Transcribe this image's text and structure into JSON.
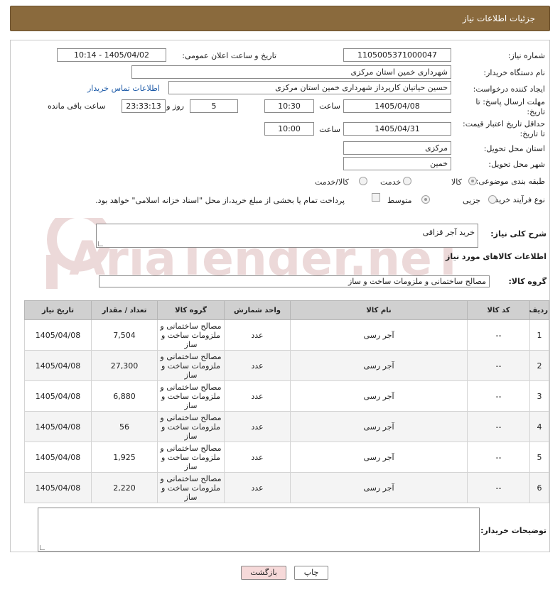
{
  "header": {
    "title": "جزئیات اطلاعات نیاز"
  },
  "fields": {
    "need_number_label": "شماره نیاز:",
    "need_number": "1105005371000047",
    "announce_label": "تاریخ و ساعت اعلان عمومی:",
    "announce_value": "1405/04/02 - 10:14",
    "buyer_org_label": "نام دستگاه خریدار:",
    "buyer_org": "شهرداری خمین استان مرکزی",
    "creator_label": "ایجاد کننده درخواست:",
    "creator": "حسین حیاتیان کارپرداز شهرداری خمین استان مرکزی",
    "contact_link": "اطلاعات تماس خریدار",
    "deadline_label": "مهلت ارسال پاسخ: تا تاریخ:",
    "deadline_date": "1405/04/08",
    "time_label": "ساعت",
    "deadline_time": "10:30",
    "days_value": "5",
    "days_label": "روز و",
    "remaining_time": "23:33:13",
    "remaining_label": "ساعت باقی مانده",
    "validity_label": "حداقل تاریخ اعتبار قیمت: تا تاریخ:",
    "validity_date": "1405/04/31",
    "validity_time": "10:00",
    "province_label": "استان محل تحویل:",
    "province": "مرکزی",
    "city_label": "شهر محل تحویل:",
    "city": "خمین",
    "category_label": "طبقه بندی موضوعی:",
    "category_options": [
      "کالا",
      "خدمت",
      "کالا/خدمت"
    ],
    "process_label": "نوع فرآیند خرید :",
    "process_options": [
      "جزیی",
      "متوسط"
    ],
    "payment_note": "پرداخت تمام یا بخشی از مبلغ خرید،از محل \"اسناد خزانه اسلامی\" خواهد بود."
  },
  "description": {
    "label": "شرح کلی نیاز:",
    "value": "خرید آجر قزاقی"
  },
  "goods_info_title": "اطلاعات کالاهای مورد نیاز",
  "goods_group": {
    "label": "گروه کالا:",
    "value": "مصالح ساختمانی و ملزومات ساخت و ساز"
  },
  "table": {
    "headers": [
      "ردیف",
      "کد کالا",
      "نام کالا",
      "واحد شمارش",
      "گروه کالا",
      "تعداد / مقدار",
      "تاریخ نیاز"
    ],
    "rows": [
      {
        "row": "1",
        "code": "--",
        "name": "آجر رسی",
        "unit": "عدد",
        "group": "مصالح ساختمانی و ملزومات ساخت و ساز",
        "qty": "7,504",
        "date": "1405/04/08"
      },
      {
        "row": "2",
        "code": "--",
        "name": "آجر رسی",
        "unit": "عدد",
        "group": "مصالح ساختمانی و ملزومات ساخت و ساز",
        "qty": "27,300",
        "date": "1405/04/08"
      },
      {
        "row": "3",
        "code": "--",
        "name": "آجر رسی",
        "unit": "عدد",
        "group": "مصالح ساختمانی و ملزومات ساخت و ساز",
        "qty": "6,880",
        "date": "1405/04/08"
      },
      {
        "row": "4",
        "code": "--",
        "name": "آجر رسی",
        "unit": "عدد",
        "group": "مصالح ساختمانی و ملزومات ساخت و ساز",
        "qty": "56",
        "date": "1405/04/08"
      },
      {
        "row": "5",
        "code": "--",
        "name": "آجر رسی",
        "unit": "عدد",
        "group": "مصالح ساختمانی و ملزومات ساخت و ساز",
        "qty": "1,925",
        "date": "1405/04/08"
      },
      {
        "row": "6",
        "code": "--",
        "name": "آجر رسی",
        "unit": "عدد",
        "group": "مصالح ساختمانی و ملزومات ساخت و ساز",
        "qty": "2,220",
        "date": "1405/04/08"
      }
    ]
  },
  "buyer_notes": {
    "label": "توضیحات خریدار:",
    "value": ""
  },
  "buttons": {
    "print": "چاپ",
    "back": "بازگشت"
  },
  "watermark_text": "AriaTender.neT",
  "colors": {
    "header_bg": "#8a6a3d",
    "table_header_bg": "#d0d0d0",
    "back_button_bg": "#f6d9d9",
    "print_button_bg": "#ffffff"
  }
}
